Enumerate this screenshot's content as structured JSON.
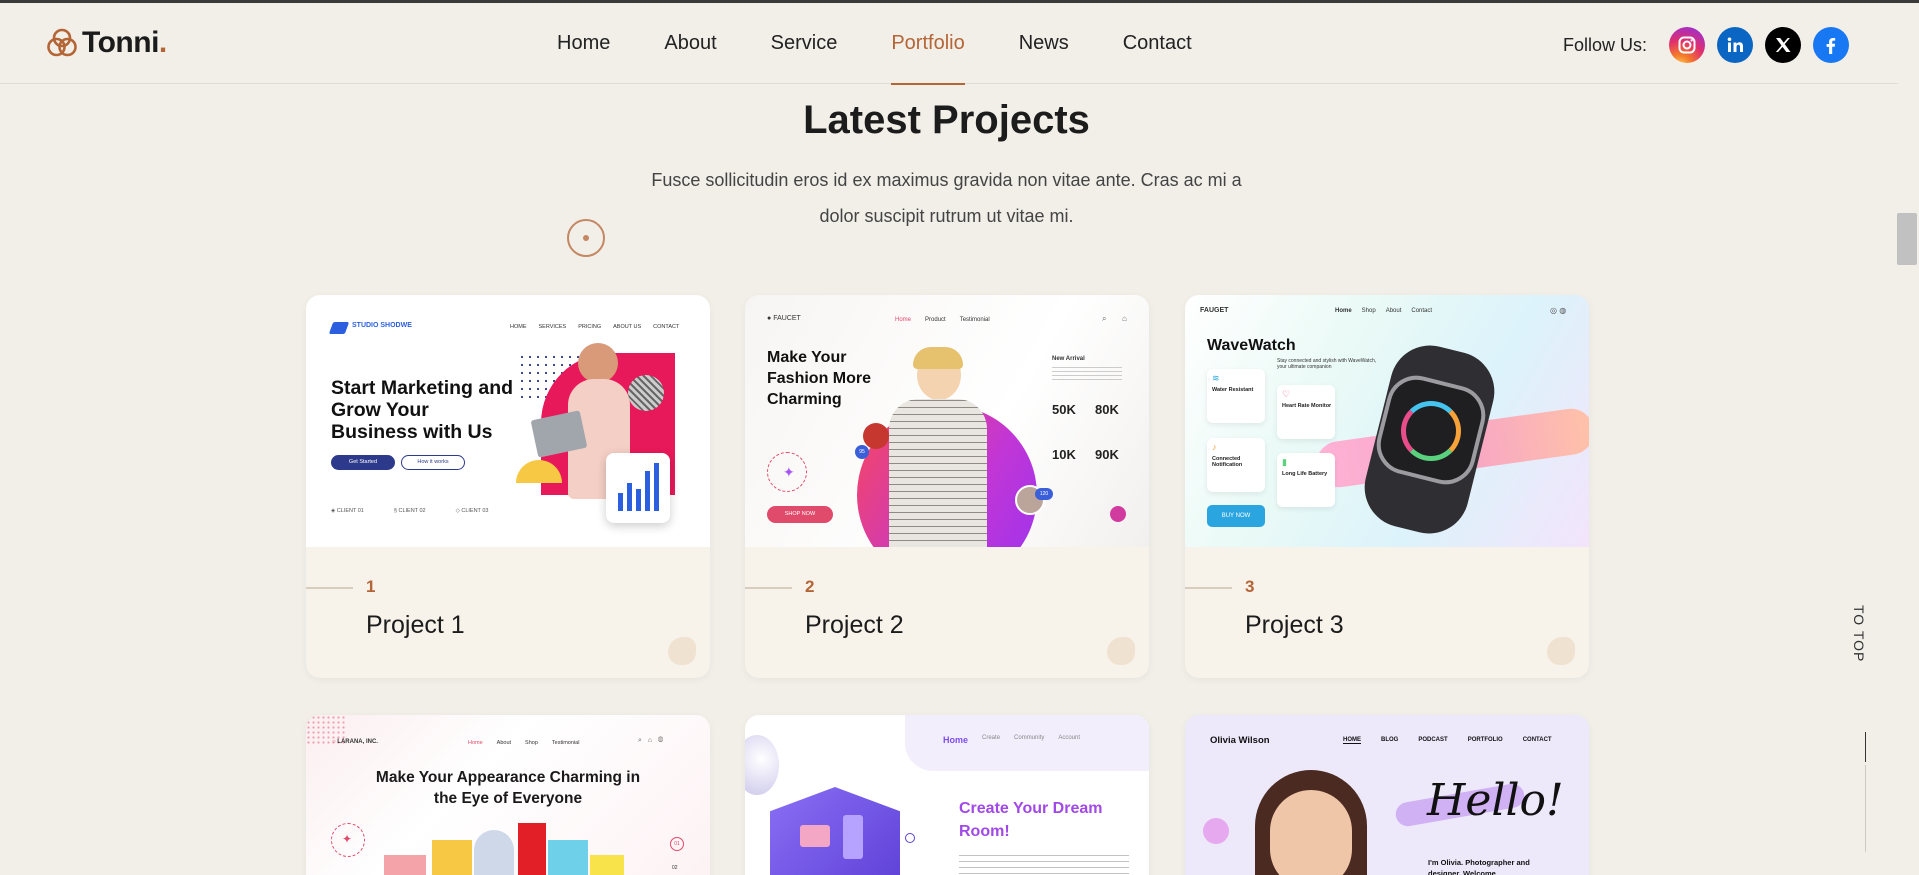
{
  "header": {
    "logo": "Tonni",
    "nav": [
      "Home",
      "About",
      "Service",
      "Portfolio",
      "News",
      "Contact"
    ],
    "active_nav": "Portfolio",
    "follow_label": "Follow Us:",
    "socials": [
      "instagram-icon",
      "linkedin-icon",
      "x-icon",
      "facebook-icon"
    ]
  },
  "section": {
    "title": "Latest Projects",
    "description": "Fusce sollicitudin eros id ex maximus gravida non vitae ante. Cras ac mi a dolor suscipit rutrum ut vitae mi."
  },
  "projects": [
    {
      "num": "1",
      "title": "Project 1",
      "thumb": {
        "brand": "STUDIO SHODWE",
        "menu": [
          "HOME",
          "SERVICES",
          "PRICING",
          "ABOUT US",
          "CONTACT"
        ],
        "headline": "Start Marketing and Grow Your Business with Us",
        "primary_btn": "Get Started",
        "secondary_btn": "How it works",
        "clients": [
          "CLIENT 01",
          "CLIENT 02",
          "CLIENT 03"
        ]
      }
    },
    {
      "num": "2",
      "title": "Project 2",
      "thumb": {
        "brand": "FAUCET",
        "menu": [
          "Home",
          "Product",
          "Testimonial"
        ],
        "headline": "Make Your Fashion More Charming",
        "new_arrival": "New Arrival",
        "stats": [
          "50K",
          "80K",
          "10K",
          "90K"
        ],
        "cta": "SHOP NOW",
        "badge": "120"
      }
    },
    {
      "num": "3",
      "title": "Project 3",
      "thumb": {
        "brand": "FAUGET",
        "menu": [
          "Home",
          "Shop",
          "About",
          "Contact"
        ],
        "headline": "WaveWatch",
        "tagline": "Stay connected and stylish with WaveWatch, your ultimate companion",
        "features": [
          "Water Resistant",
          "Heart Rate Monitor",
          "Connected Notification",
          "Long Life Battery"
        ],
        "cta": "BUY NOW"
      }
    },
    {
      "thumb": {
        "brand": "LARANA, INC.",
        "menu": [
          "Home",
          "About",
          "Shop",
          "Testimonial"
        ],
        "headline": "Make Your Appearance Charming in the Eye of Everyone",
        "pager": [
          "01",
          "02"
        ]
      }
    },
    {
      "thumb": {
        "menu": [
          "Home",
          "Create",
          "Community",
          "Account"
        ],
        "headline": "Create Your Dream Room!"
      }
    },
    {
      "thumb": {
        "brand": "Olivia Wilson",
        "menu": [
          "HOME",
          "BLOG",
          "PODCAST",
          "PORTFOLIO",
          "CONTACT"
        ],
        "headline": "Hello!",
        "intro": "I'm Olivia. Photographer and designer. Welcome"
      }
    }
  ],
  "to_top": "TO TOP",
  "colors": {
    "accent": "#b46536",
    "background": "#f2efe9",
    "card": "#f7f2ea"
  }
}
